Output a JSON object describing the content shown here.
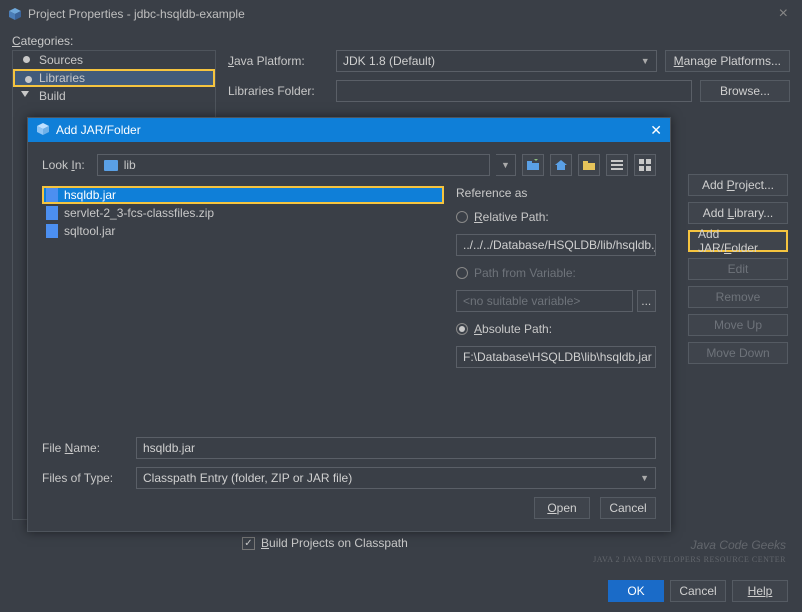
{
  "window": {
    "title": "Project Properties - jdbc-hsqldb-example",
    "categories_label": "Categories:"
  },
  "tree": {
    "items": [
      "Sources",
      "Libraries",
      "Build"
    ],
    "selected": "Libraries"
  },
  "form": {
    "java_platform_label": "Java Platform:",
    "java_platform_value": "JDK 1.8 (Default)",
    "manage_platforms": "Manage Platforms...",
    "libraries_folder_label": "Libraries Folder:",
    "libraries_folder_value": "",
    "browse": "Browse..."
  },
  "side_buttons": {
    "add_project": "Add Project...",
    "add_library": "Add Library...",
    "add_jar": "Add JAR/Folder",
    "edit": "Edit",
    "remove": "Remove",
    "move_up": "Move Up",
    "move_down": "Move Down"
  },
  "checkbox": {
    "label": "Build Projects on Classpath",
    "checked": true
  },
  "bottom": {
    "ok": "OK",
    "cancel": "Cancel",
    "help": "Help"
  },
  "dialog": {
    "title": "Add JAR/Folder",
    "look_in_label": "Look In:",
    "look_in_value": "lib",
    "files": [
      "hsqldb.jar",
      "servlet-2_3-fcs-classfiles.zip",
      "sqltool.jar"
    ],
    "selected_file": "hsqldb.jar",
    "reference": {
      "header": "Reference as",
      "relative_label": "Relative Path:",
      "relative_value": "../../../Database/HSQLDB/lib/hsqldb.jar",
      "variable_label": "Path from Variable:",
      "variable_value": "<no suitable variable>",
      "absolute_label": "Absolute Path:",
      "absolute_value": "F:\\Database\\HSQLDB\\lib\\hsqldb.jar",
      "selected": "absolute"
    },
    "file_name_label": "File Name:",
    "file_name_value": "hsqldb.jar",
    "files_of_type_label": "Files of Type:",
    "files_of_type_value": "Classpath Entry (folder, ZIP or JAR file)",
    "open": "Open",
    "cancel": "Cancel"
  },
  "watermark": {
    "line1": "Java Code Geeks",
    "line2": "JAVA 2 JAVA DEVELOPERS RESOURCE CENTER"
  }
}
